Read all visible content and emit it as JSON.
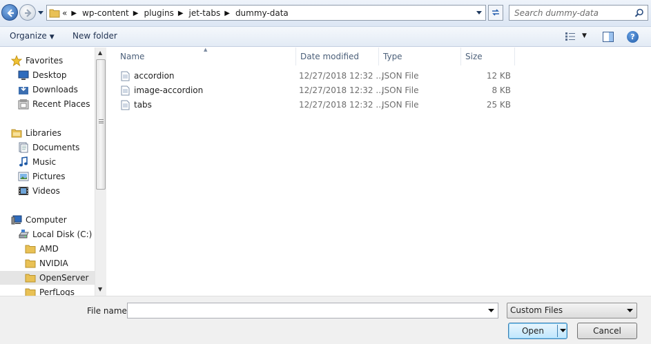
{
  "address": {
    "crumbs": [
      "wp-content",
      "plugins",
      "jet-tabs",
      "dummy-data"
    ],
    "overflow_marker": "«"
  },
  "search": {
    "placeholder": "Search dummy-data"
  },
  "toolbar": {
    "organize_label": "Organize",
    "new_folder_label": "New folder"
  },
  "nav": {
    "favorites": {
      "label": "Favorites",
      "items": [
        "Desktop",
        "Downloads",
        "Recent Places"
      ]
    },
    "libraries": {
      "label": "Libraries",
      "items": [
        "Documents",
        "Music",
        "Pictures",
        "Videos"
      ]
    },
    "computer": {
      "label": "Computer",
      "drive": "Local Disk (C:)",
      "folders": [
        "AMD",
        "NVIDIA",
        "OpenServer",
        "PerfLogs"
      ],
      "selected": "OpenServer"
    }
  },
  "columns": {
    "name": "Name",
    "date": "Date modified",
    "type": "Type",
    "size": "Size"
  },
  "files": [
    {
      "name": "accordion",
      "date": "12/27/2018 12:32 ...",
      "type": "JSON File",
      "size": "12 KB"
    },
    {
      "name": "image-accordion",
      "date": "12/27/2018 12:32 ...",
      "type": "JSON File",
      "size": "8 KB"
    },
    {
      "name": "tabs",
      "date": "12/27/2018 12:32 ...",
      "type": "JSON File",
      "size": "25 KB"
    }
  ],
  "bottom": {
    "file_name_label": "File name:",
    "file_name_value": "",
    "filter_value": "Custom Files",
    "open_label": "Open",
    "cancel_label": "Cancel"
  },
  "colors": {
    "selected_bg": "#e5e5e5",
    "header_text": "#4c607a",
    "open_button_border": "#3c7fb1"
  }
}
